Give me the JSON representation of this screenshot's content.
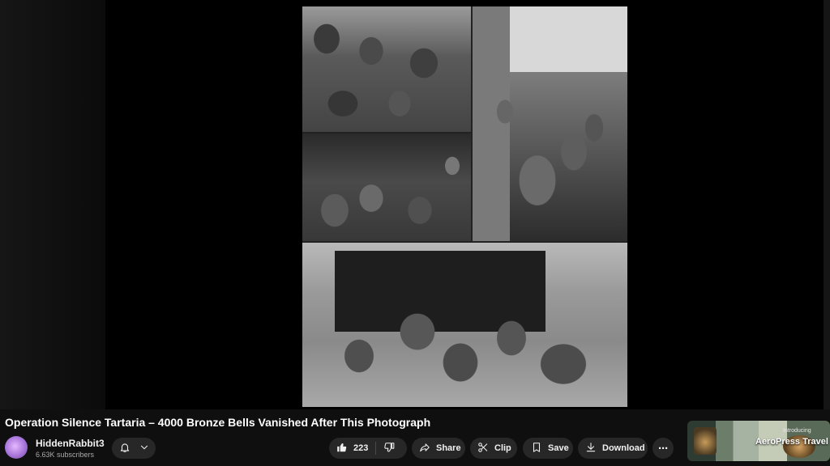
{
  "video": {
    "title": "Operation Silence Tartaria – 4000 Bronze Bells Vanished After This Photograph"
  },
  "channel": {
    "name": "HiddenRabbit3",
    "subscribers": "6.63K subscribers"
  },
  "actions": {
    "like_count": "223",
    "share_label": "Share",
    "clip_label": "Clip",
    "save_label": "Save",
    "download_label": "Download",
    "more_label": "···"
  },
  "ad": {
    "intro": "Introducing",
    "title": "AeroPress Travel G"
  }
}
